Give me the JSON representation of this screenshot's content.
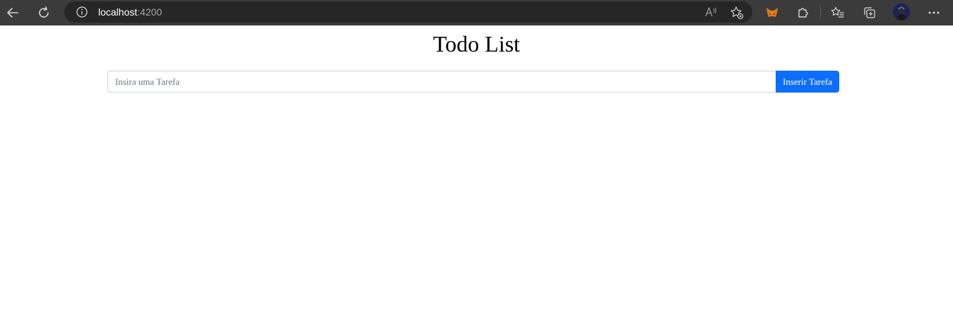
{
  "browser": {
    "url_host": "localhost",
    "url_port": ":4200",
    "colors": {
      "toolbar": "#3b3b3b",
      "address_bar": "#262626",
      "icon": "#d6d6d6"
    }
  },
  "page": {
    "title": "Todo List",
    "task_input": {
      "placeholder": "Insira uma Tarefa",
      "value": ""
    },
    "add_button_label": "Inserir Tarefa",
    "colors": {
      "button": "#0d6efd",
      "input_border": "#ced4da"
    }
  }
}
